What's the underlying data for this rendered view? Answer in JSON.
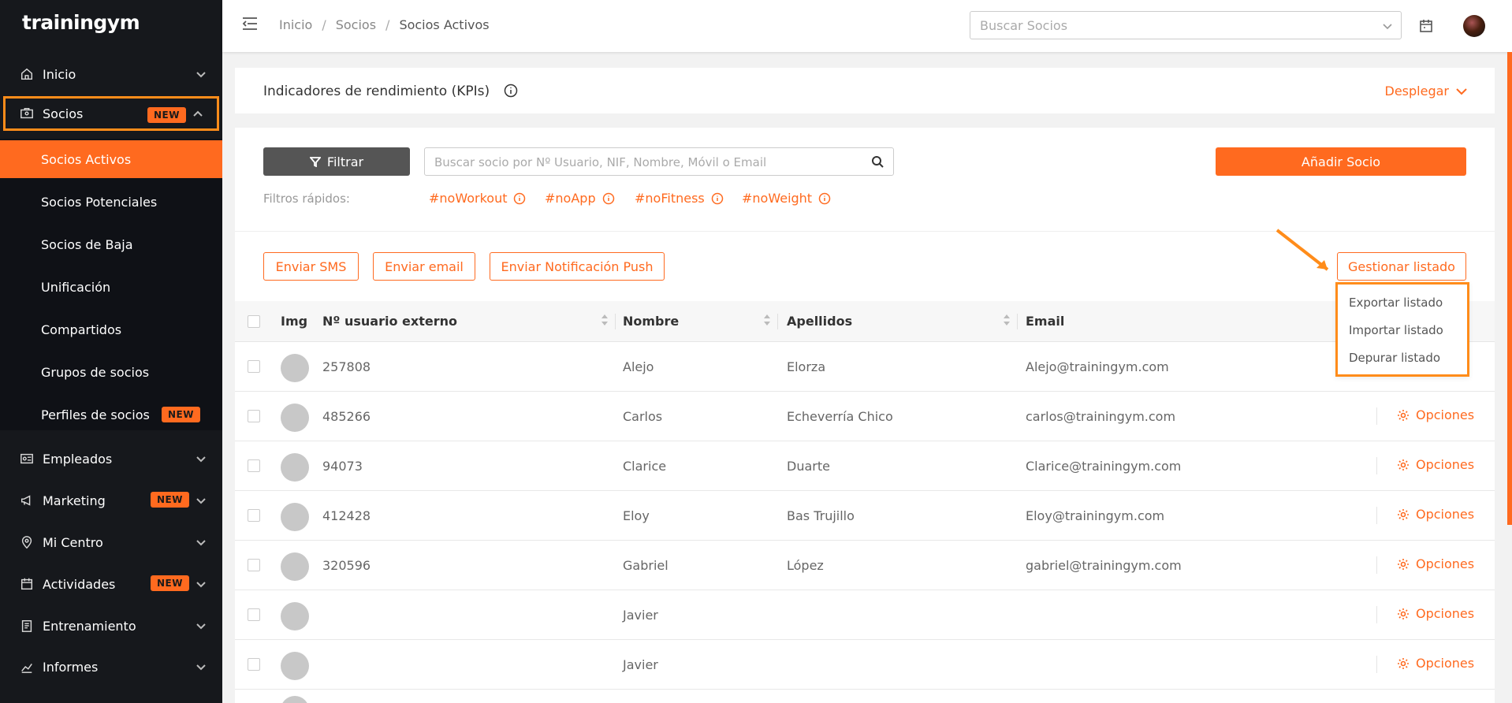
{
  "sidebar": {
    "logo": "trainingym",
    "items": [
      {
        "label": "Inicio"
      },
      {
        "label": "Socios",
        "badge": "NEW"
      },
      {
        "label": "Empleados"
      },
      {
        "label": "Marketing",
        "badge": "NEW"
      },
      {
        "label": "Mi Centro"
      },
      {
        "label": "Actividades",
        "badge": "NEW"
      },
      {
        "label": "Entrenamiento"
      },
      {
        "label": "Informes"
      }
    ],
    "sub_items": [
      {
        "label": "Socios Activos"
      },
      {
        "label": "Socios Potenciales"
      },
      {
        "label": "Socios de Baja"
      },
      {
        "label": "Unificación"
      },
      {
        "label": "Compartidos"
      },
      {
        "label": "Grupos de socios"
      },
      {
        "label": "Perfiles de socios",
        "badge": "NEW"
      }
    ]
  },
  "header": {
    "breadcrumb": [
      "Inicio",
      "Socios",
      "Socios Activos"
    ],
    "breadcrumb_sep": "/",
    "search_placeholder": "Buscar Socios"
  },
  "kpi": {
    "title": "Indicadores de rendimiento (KPIs)",
    "expand_label": "Desplegar"
  },
  "toolbar": {
    "filter_label": "Filtrar",
    "search_placeholder": "Buscar socio por Nº Usuario, NIF, Nombre, Móvil o Email",
    "add_label": "Añadir Socio",
    "quick_filters_label": "Filtros rápidos:",
    "quick_filters": [
      "#noWorkout",
      "#noApp",
      "#noFitness",
      "#noWeight"
    ],
    "actions": [
      "Enviar SMS",
      "Enviar email",
      "Enviar Notificación Push"
    ],
    "manage_label": "Gestionar listado"
  },
  "manage_menu": [
    "Exportar listado",
    "Importar listado",
    "Depurar listado"
  ],
  "table": {
    "columns": [
      "Img",
      "Nº usuario externo",
      "Nombre",
      "Apellidos",
      "Email"
    ],
    "options_label": "Opciones",
    "rows": [
      {
        "id": "257808",
        "nombre": "Alejo",
        "apellidos": "Elorza",
        "email": "Alejo@trainingym.com"
      },
      {
        "id": "485266",
        "nombre": "Carlos",
        "apellidos": "Echeverría Chico",
        "email": "carlos@trainingym.com"
      },
      {
        "id": "94073",
        "nombre": "Clarice",
        "apellidos": "Duarte",
        "email": "Clarice@trainingym.com"
      },
      {
        "id": "412428",
        "nombre": "Eloy",
        "apellidos": "Bas Trujillo",
        "email": "Eloy@trainingym.com"
      },
      {
        "id": "320596",
        "nombre": "Gabriel",
        "apellidos": "López",
        "email": "gabriel@trainingym.com"
      },
      {
        "id": "",
        "nombre": "Javier",
        "apellidos": "",
        "email": ""
      },
      {
        "id": "",
        "nombre": "Javier",
        "apellidos": "",
        "email": ""
      }
    ]
  },
  "colors": {
    "accent": "#ff6a1f",
    "sidebar_bg": "#16181c",
    "highlight": "#ff8c1a"
  }
}
